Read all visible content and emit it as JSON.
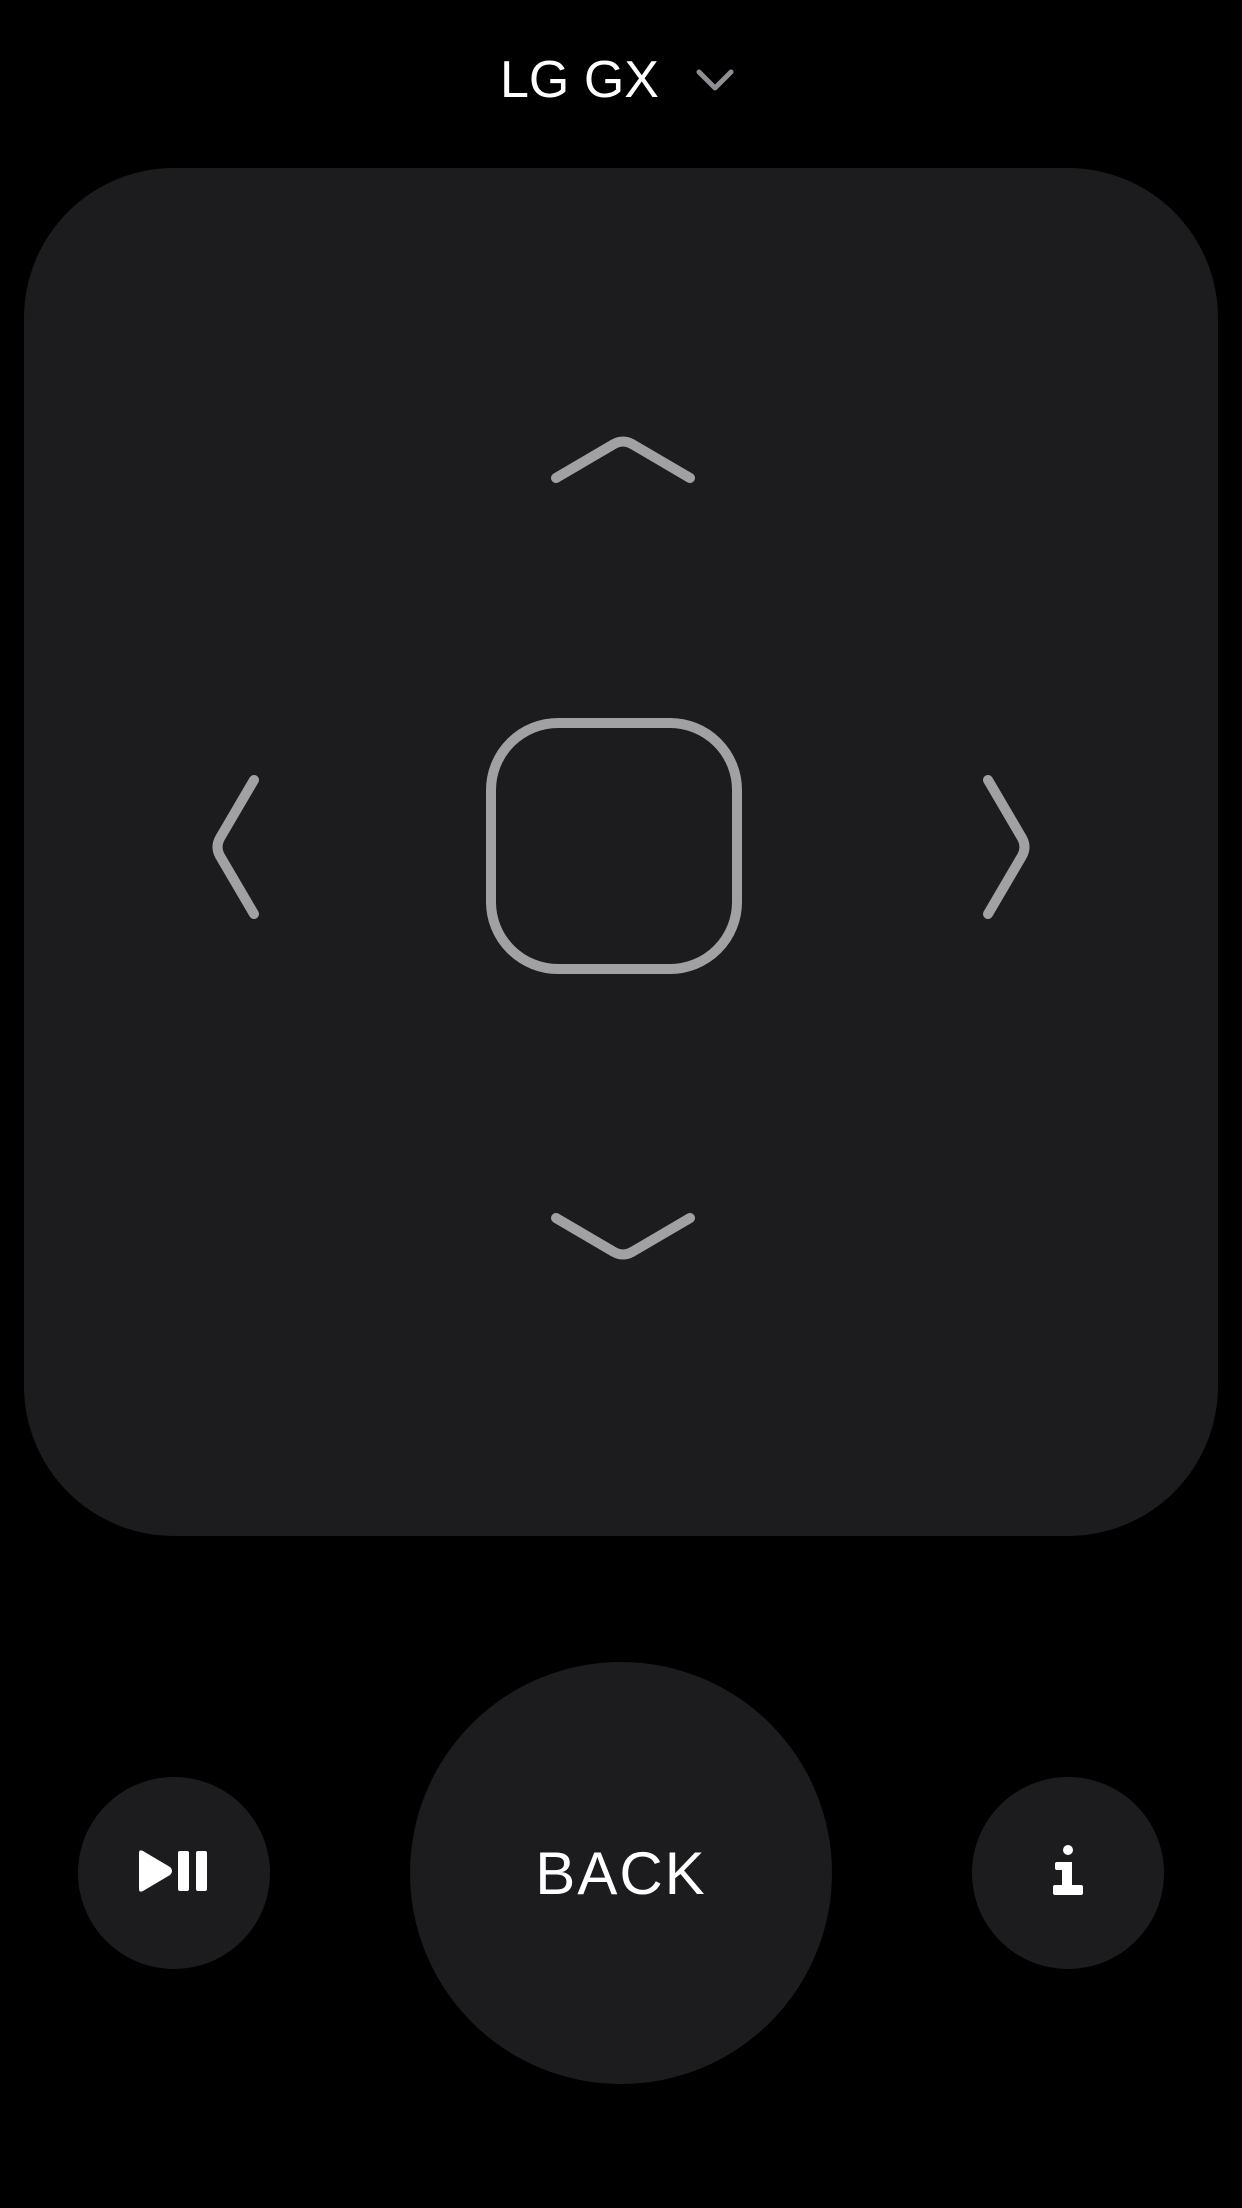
{
  "header": {
    "device_name": "LG GX",
    "chevron_icon": "chevron-down-icon"
  },
  "touchpad": {
    "up_icon": "chevron-up-icon",
    "down_icon": "chevron-down-icon",
    "left_icon": "chevron-left-icon",
    "right_icon": "chevron-right-icon",
    "center_icon": "select-square-icon"
  },
  "controls": {
    "play_pause_icon": "play-pause-icon",
    "back_label": "BACK",
    "info_icon": "info-icon"
  },
  "colors": {
    "background": "#000000",
    "surface": "#1c1c1e",
    "arrow": "#a1a1a3",
    "text": "#ffffff",
    "chevron": "#8e8e93"
  }
}
